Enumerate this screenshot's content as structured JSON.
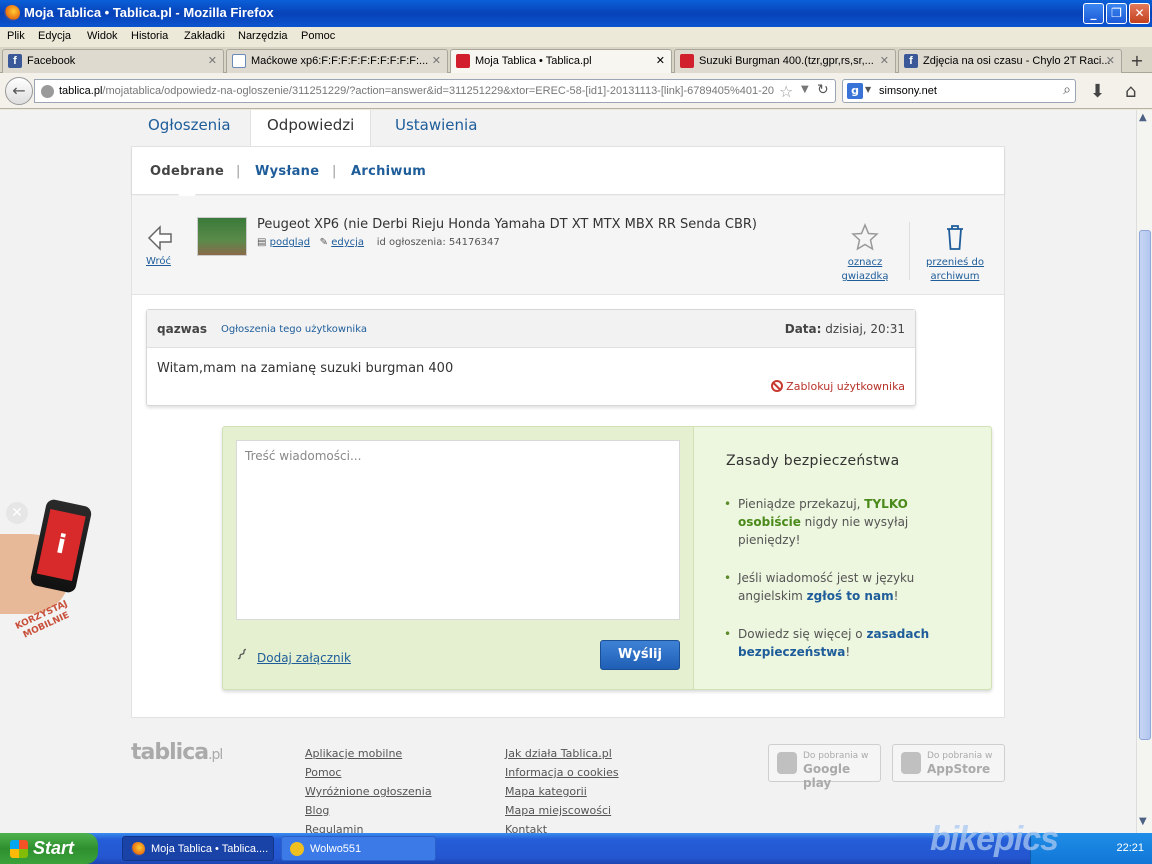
{
  "window": {
    "title": "Moja Tablica • Tablica.pl - Mozilla Firefox"
  },
  "menubar": [
    "Plik",
    "Edycja",
    "Widok",
    "Historia",
    "Zakładki",
    "Narzędzia",
    "Pomoc"
  ],
  "tabs": [
    {
      "label": "Facebook",
      "icon": "facebook-icon"
    },
    {
      "label": "Maćkowe xp6:F:F:F:F:F:F:F:F:F:F:...",
      "icon": "page-icon"
    },
    {
      "label": "Moja Tablica • Tablica.pl",
      "icon": "tablica-icon"
    },
    {
      "label": "Suzuki Burgman 400.(tzr,gpr,rs,sr,...",
      "icon": "tablica-icon"
    },
    {
      "label": "Zdjęcia na osi czasu - Chylo 2T Raci...",
      "icon": "facebook-icon"
    }
  ],
  "navbar": {
    "url_host": "tablica.pl",
    "url_path": "/mojatablica/odpowiedz-na-ogloszenie/311251229/?action=answer&id=311251229&xtor=EREC-58-[id1]-20131113-[link]-6789405%401-20",
    "search_value": "simsony.net"
  },
  "page": {
    "main_tabs": [
      "Ogłoszenia",
      "Odpowiedzi",
      "Ustawienia"
    ],
    "sub_tabs": [
      "Odebrane",
      "Wysłane",
      "Archiwum"
    ],
    "ad": {
      "back_label": "Wróć",
      "title": "Peugeot XP6 (nie Derbi Rieju Honda Yamaha DT XT MTX MBX RR Senda CBR)",
      "preview_label": "podgląd",
      "edit_label": "edycja",
      "id_label": "id ogłoszenia: 54176347",
      "star_label_1": "oznacz",
      "star_label_2": "gwiazdką",
      "archive_label_1": "przenieś do",
      "archive_label_2": "archiwum"
    },
    "message": {
      "user": "qazwas",
      "user_ads_link": "Ogłoszenia tego użytkownika",
      "date_label": "Data:",
      "date_value": "dzisiaj, 20:31",
      "body": "Witam,mam na zamianę suzuki burgman 400",
      "block_label": "Zablokuj użytkownika"
    },
    "reply": {
      "placeholder": "Treść wiadomości...",
      "attach_label": "Dodaj załącznik",
      "send_label": "Wyślij"
    },
    "safety": {
      "title": "Zasady bezpieczeństwa",
      "tip1_a": "Pieniądze przekazuj, ",
      "tip1_b": "TYLKO osobiście",
      "tip1_c": " nigdy nie wysyłaj pieniędzy!",
      "tip2_a": "Jeśli wiadomość jest w języku angielskim ",
      "tip2_b": "zgłoś to nam",
      "tip2_c": "!",
      "tip3_a": "Dowiedz się więcej o ",
      "tip3_b": "zasadach bezpieczeństwa",
      "tip3_c": "!"
    },
    "footer": {
      "logo": "tablica",
      "logo_suffix": ".pl",
      "col1": [
        "Aplikacje mobilne",
        "Pomoc",
        "Wyróżnione ogłoszenia",
        "Blog",
        "Regulamin"
      ],
      "col2": [
        "Jak działa Tablica.pl",
        "Informacja o cookies",
        "Mapa kategorii",
        "Mapa miejscowości",
        "Kontakt"
      ],
      "google_small": "Do pobrania w",
      "google_big": "Google play",
      "apple_small": "Do pobrania w",
      "apple_big": "AppStore"
    },
    "mobile_promo": {
      "text_1": "KORZYSTAJ",
      "text_2": "MOBILNIE"
    }
  },
  "taskbar": {
    "start_label": "Start",
    "items": [
      "Moja Tablica • Tablica....",
      "Wolwo551"
    ],
    "clock": "22:21"
  },
  "watermark": "bikepics"
}
